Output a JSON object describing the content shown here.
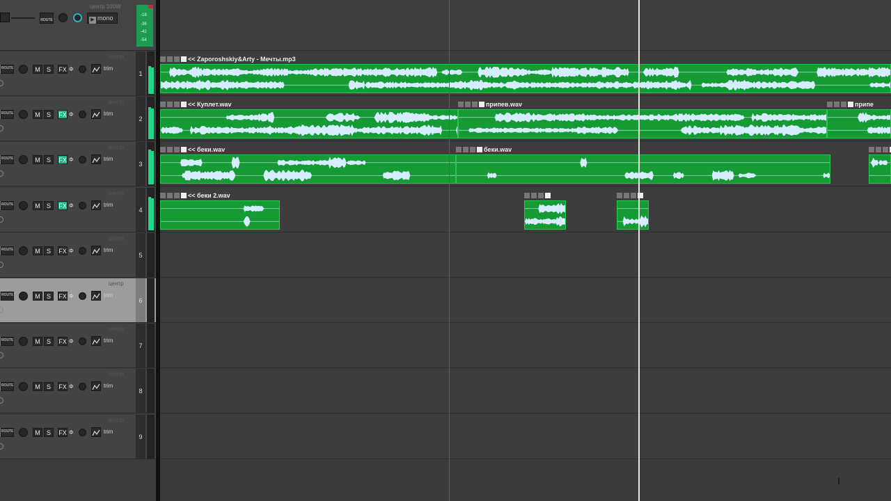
{
  "master": {
    "pan_label": "центр 100W",
    "route_label": "ROUTE",
    "mono_label": "mono",
    "meter_labels": [
      "-18",
      "-36",
      "-42",
      "-54"
    ]
  },
  "track_controls": {
    "mute": "M",
    "solo": "S",
    "fx": "FX",
    "power": "Φ",
    "trim": "trim",
    "route": "ROUTE",
    "pan": "центр"
  },
  "tracks": [
    {
      "number": "1",
      "fx_active": false,
      "selected": false
    },
    {
      "number": "2",
      "fx_active": true,
      "selected": false
    },
    {
      "number": "3",
      "fx_active": true,
      "selected": false
    },
    {
      "number": "4",
      "fx_active": true,
      "selected": false
    },
    {
      "number": "5",
      "fx_active": false,
      "selected": false
    },
    {
      "number": "6",
      "fx_active": false,
      "selected": true
    },
    {
      "number": "7",
      "fx_active": false,
      "selected": false
    },
    {
      "number": "8",
      "fx_active": false,
      "selected": false
    },
    {
      "number": "9",
      "fx_active": false,
      "selected": false
    }
  ],
  "items": [
    {
      "track": 1,
      "name": "<< Zaporoshskiy&Arty - Мечты.mp3"
    },
    {
      "track": 2,
      "name": "<< Куплет.wav"
    },
    {
      "track": 2,
      "name": "припев.wav"
    },
    {
      "track": 2,
      "name": "припе"
    },
    {
      "track": 3,
      "name": "<< беки.wav"
    },
    {
      "track": 3,
      "name": "беки.wav"
    },
    {
      "track": 3,
      "name": ""
    },
    {
      "track": 4,
      "name": "<< беки 2.wav"
    },
    {
      "track": 4,
      "name": ""
    },
    {
      "track": 4,
      "name": ""
    }
  ],
  "colors": {
    "item_fill": "#159a34",
    "waveform": "#d6ecff",
    "play_cursor": "#d42a2a",
    "edit_cursor": "#e8e8e8",
    "fx_active": "#1fb68c",
    "meter": "#1ed886"
  }
}
